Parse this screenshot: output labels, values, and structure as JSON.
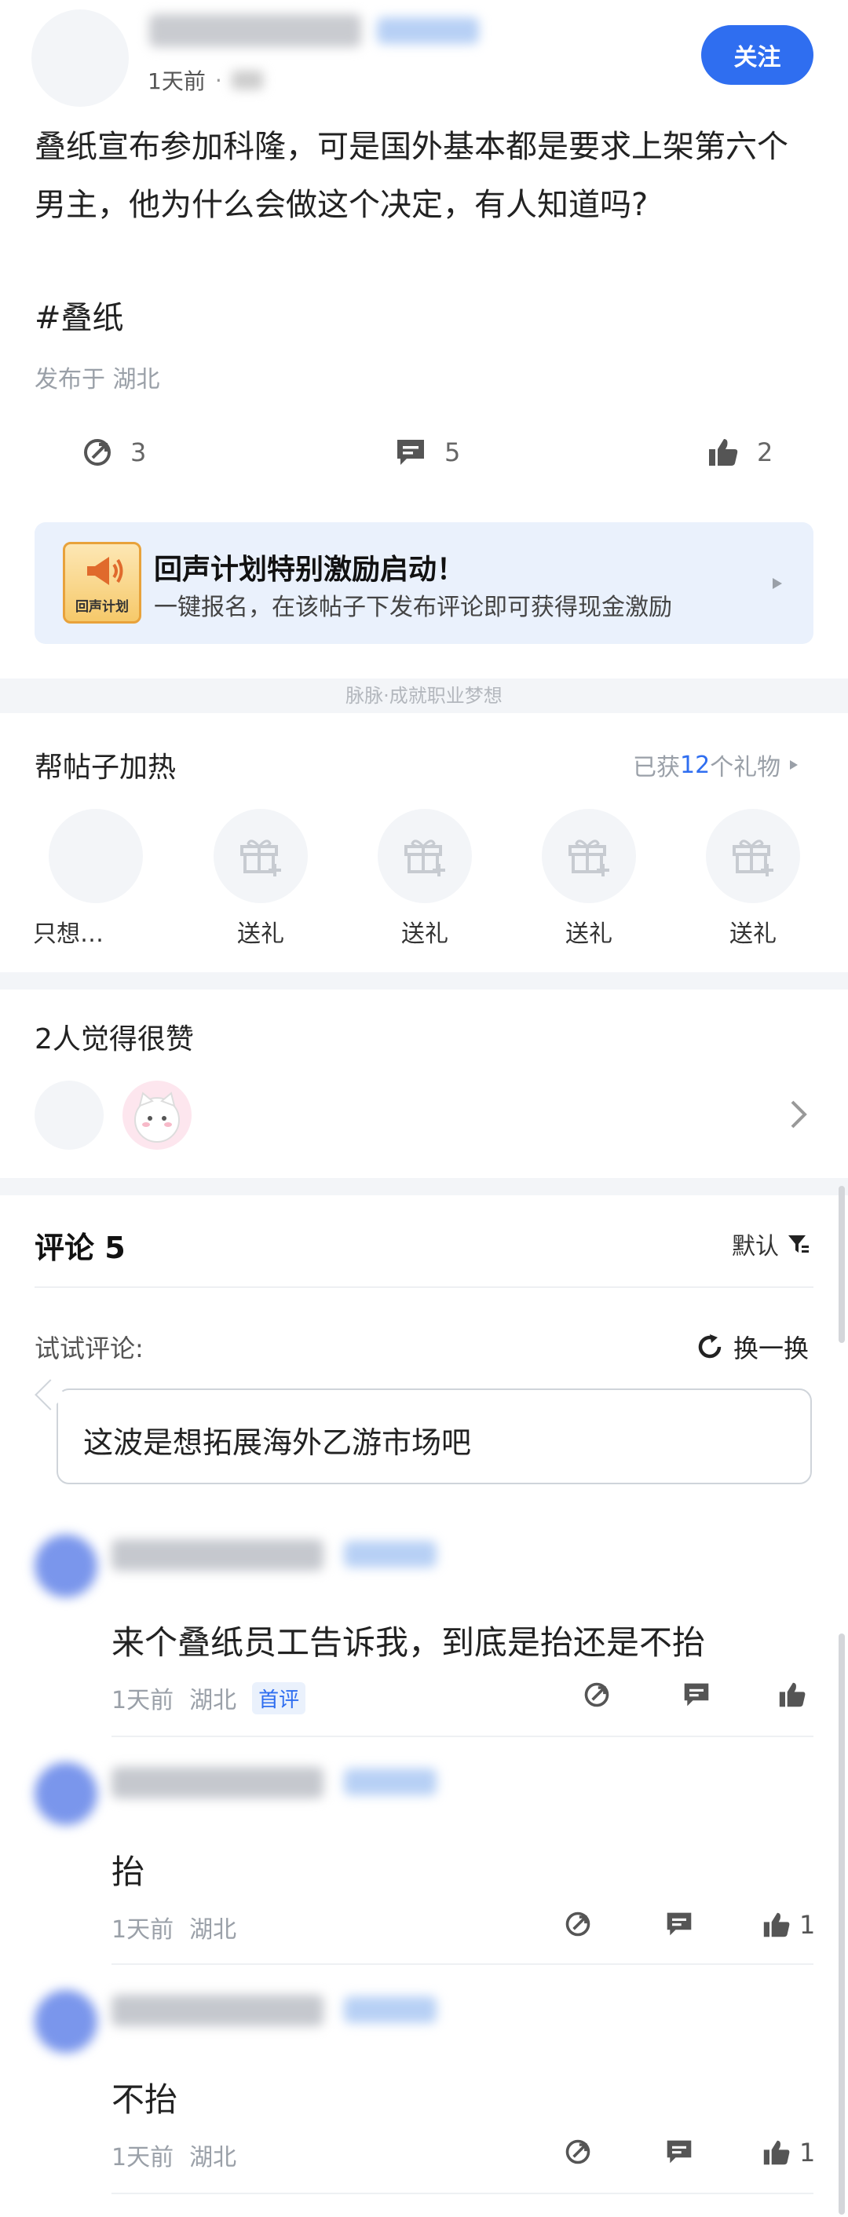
{
  "post": {
    "time": "1天前",
    "dot": "·",
    "follow_label": "关注",
    "body": "叠纸宣布参加科隆，可是国外基本都是要求上架第六个男主，他为什么会做这个决定，有人知道吗?",
    "hashtag": "#叠纸",
    "location": "发布于 湖北",
    "stats": {
      "reposts": "3",
      "comments": "5",
      "likes": "2"
    }
  },
  "banner": {
    "logo_text": "回声计划",
    "title": "回声计划特别激励启动！",
    "subtitle": "一键报名，在该帖子下发布评论即可获得现金激励"
  },
  "slogan": "脉脉·成就职业梦想",
  "gifts": {
    "title": "帮帖子加热",
    "count_prefix": "已获",
    "count": "12",
    "count_suffix": "个礼物",
    "items": [
      {
        "label": "只想…"
      },
      {
        "label": "送礼"
      },
      {
        "label": "送礼"
      },
      {
        "label": "送礼"
      },
      {
        "label": "送礼"
      }
    ]
  },
  "likes_section": {
    "title": "2人觉得很赞"
  },
  "comments": {
    "title": "评论 5",
    "sort_label": "默认",
    "try_label": "试试评论:",
    "refresh_label": "换一换",
    "suggestion": "这波是想拓展海外乙游市场吧",
    "items": [
      {
        "text": "来个叠纸员工告诉我，到底是抬还是不抬",
        "time": "1天前",
        "location": "湖北",
        "badge": "首评",
        "likes": ""
      },
      {
        "text": "抬",
        "time": "1天前",
        "location": "湖北",
        "badge": "",
        "likes": "1"
      },
      {
        "text": "不抬",
        "time": "1天前",
        "location": "湖北",
        "badge": "",
        "likes": "1"
      }
    ]
  },
  "colors": {
    "accent": "#2f6ef0",
    "band": "#f3f5f8",
    "banner_bg": "#eaf1fc"
  },
  "icons": [
    "repost-icon",
    "comment-icon",
    "thumbs-up-icon",
    "gift-icon",
    "chevron-right-icon",
    "filter-icon",
    "refresh-icon"
  ]
}
